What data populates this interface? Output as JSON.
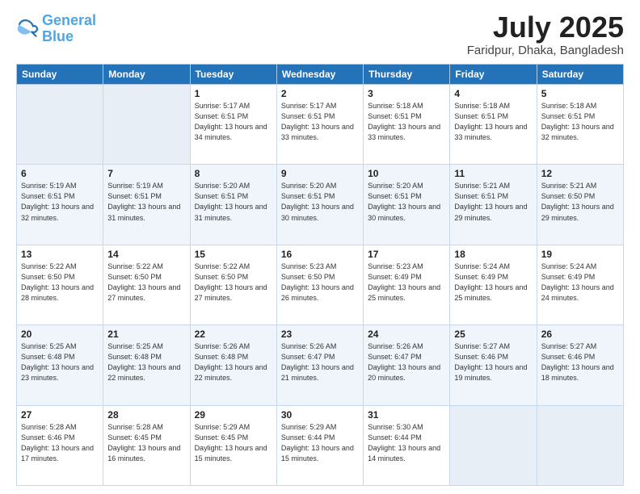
{
  "logo": {
    "line1": "General",
    "line2": "Blue"
  },
  "title": "July 2025",
  "location": "Faridpur, Dhaka, Bangladesh",
  "headers": [
    "Sunday",
    "Monday",
    "Tuesday",
    "Wednesday",
    "Thursday",
    "Friday",
    "Saturday"
  ],
  "weeks": [
    [
      {
        "day": "",
        "info": ""
      },
      {
        "day": "",
        "info": ""
      },
      {
        "day": "1",
        "info": "Sunrise: 5:17 AM\nSunset: 6:51 PM\nDaylight: 13 hours\nand 34 minutes."
      },
      {
        "day": "2",
        "info": "Sunrise: 5:17 AM\nSunset: 6:51 PM\nDaylight: 13 hours\nand 33 minutes."
      },
      {
        "day": "3",
        "info": "Sunrise: 5:18 AM\nSunset: 6:51 PM\nDaylight: 13 hours\nand 33 minutes."
      },
      {
        "day": "4",
        "info": "Sunrise: 5:18 AM\nSunset: 6:51 PM\nDaylight: 13 hours\nand 33 minutes."
      },
      {
        "day": "5",
        "info": "Sunrise: 5:18 AM\nSunset: 6:51 PM\nDaylight: 13 hours\nand 32 minutes."
      }
    ],
    [
      {
        "day": "6",
        "info": "Sunrise: 5:19 AM\nSunset: 6:51 PM\nDaylight: 13 hours\nand 32 minutes."
      },
      {
        "day": "7",
        "info": "Sunrise: 5:19 AM\nSunset: 6:51 PM\nDaylight: 13 hours\nand 31 minutes."
      },
      {
        "day": "8",
        "info": "Sunrise: 5:20 AM\nSunset: 6:51 PM\nDaylight: 13 hours\nand 31 minutes."
      },
      {
        "day": "9",
        "info": "Sunrise: 5:20 AM\nSunset: 6:51 PM\nDaylight: 13 hours\nand 30 minutes."
      },
      {
        "day": "10",
        "info": "Sunrise: 5:20 AM\nSunset: 6:51 PM\nDaylight: 13 hours\nand 30 minutes."
      },
      {
        "day": "11",
        "info": "Sunrise: 5:21 AM\nSunset: 6:51 PM\nDaylight: 13 hours\nand 29 minutes."
      },
      {
        "day": "12",
        "info": "Sunrise: 5:21 AM\nSunset: 6:50 PM\nDaylight: 13 hours\nand 29 minutes."
      }
    ],
    [
      {
        "day": "13",
        "info": "Sunrise: 5:22 AM\nSunset: 6:50 PM\nDaylight: 13 hours\nand 28 minutes."
      },
      {
        "day": "14",
        "info": "Sunrise: 5:22 AM\nSunset: 6:50 PM\nDaylight: 13 hours\nand 27 minutes."
      },
      {
        "day": "15",
        "info": "Sunrise: 5:22 AM\nSunset: 6:50 PM\nDaylight: 13 hours\nand 27 minutes."
      },
      {
        "day": "16",
        "info": "Sunrise: 5:23 AM\nSunset: 6:50 PM\nDaylight: 13 hours\nand 26 minutes."
      },
      {
        "day": "17",
        "info": "Sunrise: 5:23 AM\nSunset: 6:49 PM\nDaylight: 13 hours\nand 25 minutes."
      },
      {
        "day": "18",
        "info": "Sunrise: 5:24 AM\nSunset: 6:49 PM\nDaylight: 13 hours\nand 25 minutes."
      },
      {
        "day": "19",
        "info": "Sunrise: 5:24 AM\nSunset: 6:49 PM\nDaylight: 13 hours\nand 24 minutes."
      }
    ],
    [
      {
        "day": "20",
        "info": "Sunrise: 5:25 AM\nSunset: 6:48 PM\nDaylight: 13 hours\nand 23 minutes."
      },
      {
        "day": "21",
        "info": "Sunrise: 5:25 AM\nSunset: 6:48 PM\nDaylight: 13 hours\nand 22 minutes."
      },
      {
        "day": "22",
        "info": "Sunrise: 5:26 AM\nSunset: 6:48 PM\nDaylight: 13 hours\nand 22 minutes."
      },
      {
        "day": "23",
        "info": "Sunrise: 5:26 AM\nSunset: 6:47 PM\nDaylight: 13 hours\nand 21 minutes."
      },
      {
        "day": "24",
        "info": "Sunrise: 5:26 AM\nSunset: 6:47 PM\nDaylight: 13 hours\nand 20 minutes."
      },
      {
        "day": "25",
        "info": "Sunrise: 5:27 AM\nSunset: 6:46 PM\nDaylight: 13 hours\nand 19 minutes."
      },
      {
        "day": "26",
        "info": "Sunrise: 5:27 AM\nSunset: 6:46 PM\nDaylight: 13 hours\nand 18 minutes."
      }
    ],
    [
      {
        "day": "27",
        "info": "Sunrise: 5:28 AM\nSunset: 6:46 PM\nDaylight: 13 hours\nand 17 minutes."
      },
      {
        "day": "28",
        "info": "Sunrise: 5:28 AM\nSunset: 6:45 PM\nDaylight: 13 hours\nand 16 minutes."
      },
      {
        "day": "29",
        "info": "Sunrise: 5:29 AM\nSunset: 6:45 PM\nDaylight: 13 hours\nand 15 minutes."
      },
      {
        "day": "30",
        "info": "Sunrise: 5:29 AM\nSunset: 6:44 PM\nDaylight: 13 hours\nand 15 minutes."
      },
      {
        "day": "31",
        "info": "Sunrise: 5:30 AM\nSunset: 6:44 PM\nDaylight: 13 hours\nand 14 minutes."
      },
      {
        "day": "",
        "info": ""
      },
      {
        "day": "",
        "info": ""
      }
    ]
  ]
}
